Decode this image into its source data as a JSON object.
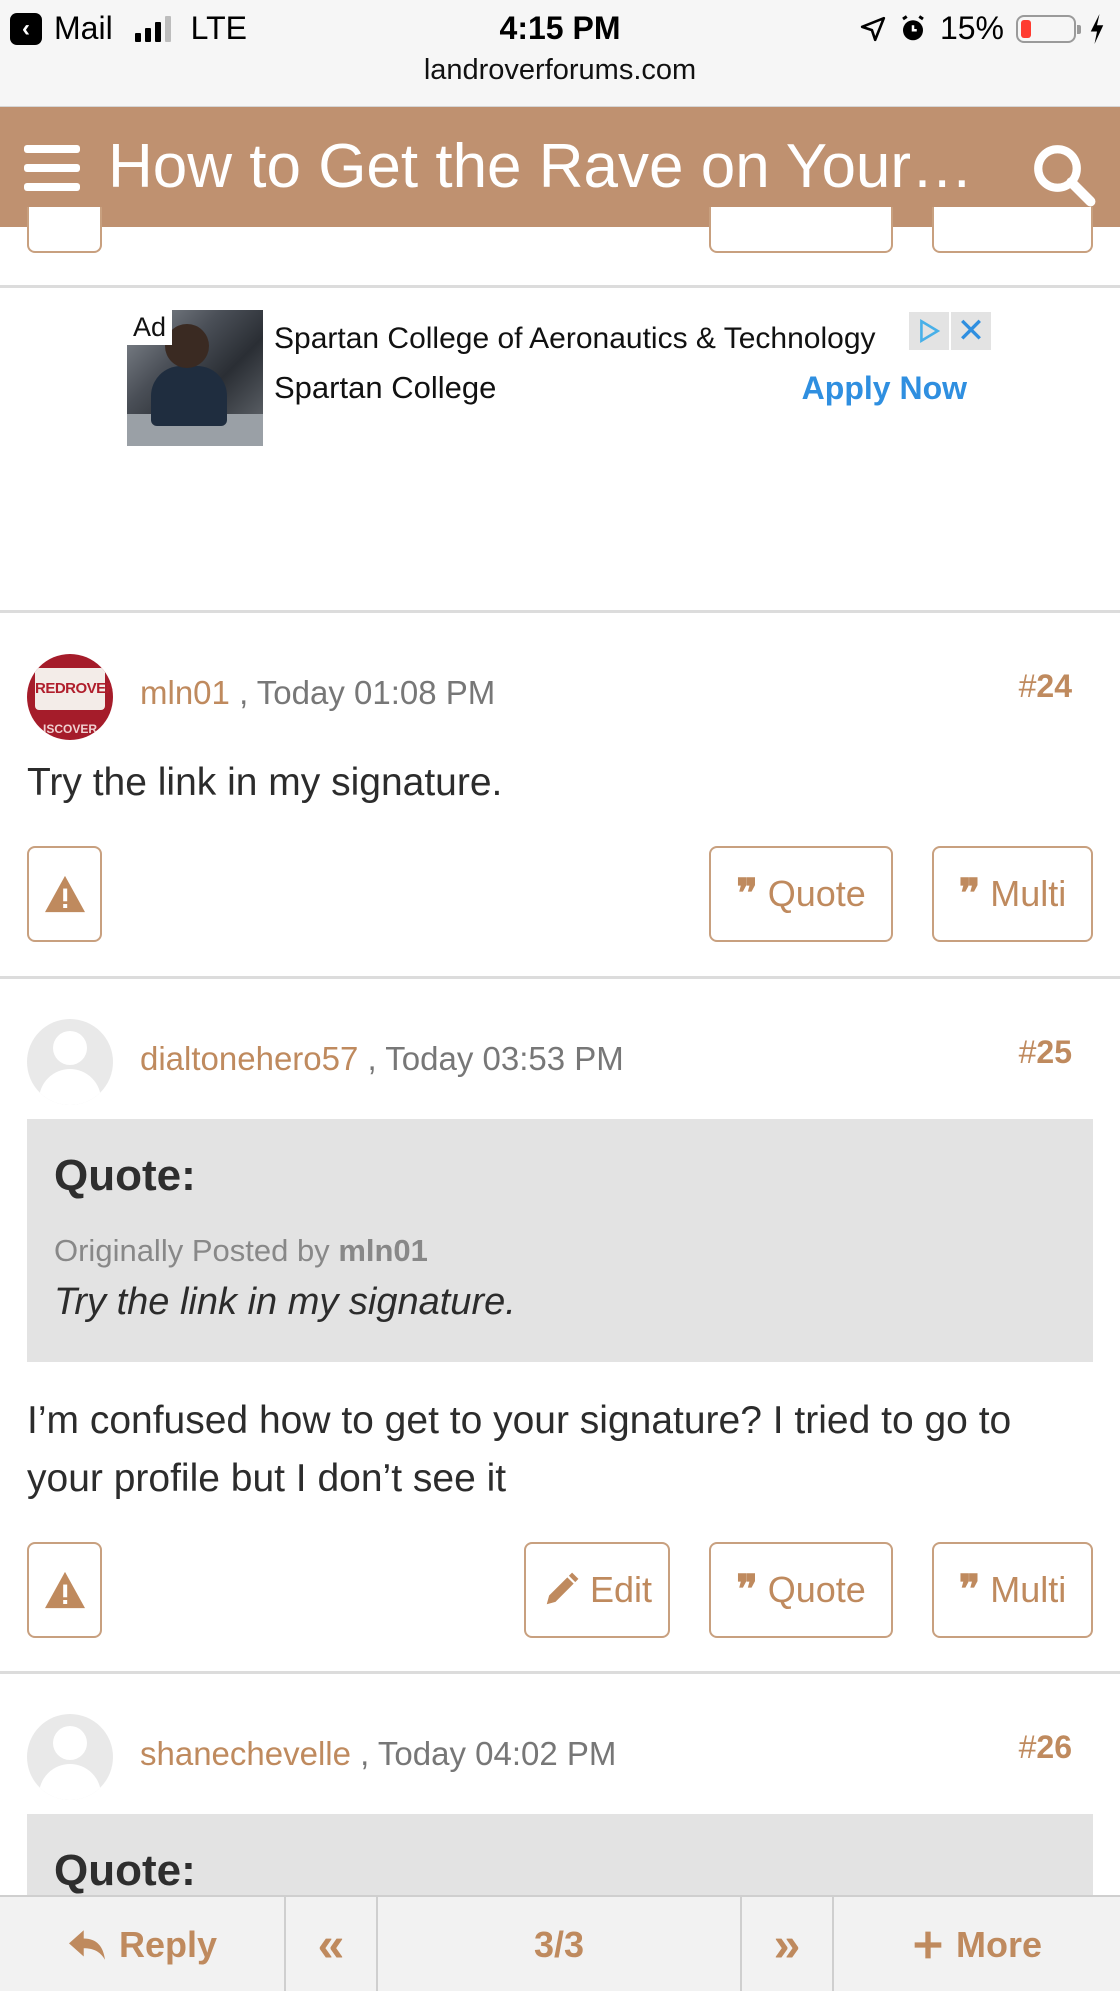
{
  "status_bar": {
    "back_label": "Mail",
    "network": "LTE",
    "time": "4:15 PM",
    "url": "landroverforums.com",
    "battery_percent": "15%",
    "battery_level": 0.15
  },
  "header": {
    "title": "How to Get the Rave on Your…"
  },
  "ad": {
    "label": "Ad",
    "headline": "Spartan College of Aeronautics & Technology",
    "advertiser": "Spartan College",
    "cta": "Apply Now"
  },
  "posts": [
    {
      "username": "mln01",
      "timestamp": ", Today 01:08 PM",
      "number": "24",
      "body": "Try the link in my signature.",
      "avatar_text": "REDROVER",
      "avatar_subtext": "ISCOVER",
      "buttons": {
        "quote": "Quote",
        "multi": "Multi"
      }
    },
    {
      "username": "dialtonehero57",
      "timestamp": ", Today 03:53 PM",
      "number": "25",
      "quote": {
        "title": "Quote:",
        "originally_posted_by": "Originally Posted by",
        "author": "mln01",
        "text": "Try the link in my signature."
      },
      "body": "I’m confused how to get to your signature? I tried to go to your profile but I don’t see it",
      "buttons": {
        "edit": "Edit",
        "quote": "Quote",
        "multi": "Multi"
      }
    },
    {
      "username": "shanechevelle",
      "timestamp": ", Today 04:02 PM",
      "number": "26",
      "quote": {
        "title": "Quote:"
      }
    }
  ],
  "post_number_prefix": "#",
  "bottom_bar": {
    "reply": "Reply",
    "first": "«",
    "page": "3/3",
    "last": "»",
    "more": "More"
  },
  "colors": {
    "brand": "#bf9170",
    "accent_text": "#bf8a5e",
    "ad_link": "#2f8fe0",
    "quote_bg": "#e3e3e3"
  }
}
